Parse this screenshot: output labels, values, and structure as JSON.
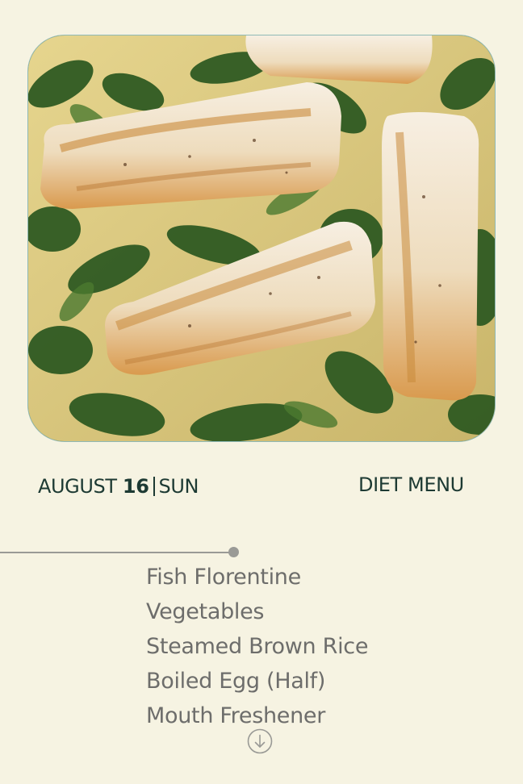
{
  "header": {
    "month": "AUGUST",
    "day": "16",
    "weekday": "SUN",
    "menu_title": "DIET MENU"
  },
  "menu": {
    "items": [
      "Fish Florentine",
      "Vegetables",
      "Steamed Brown Rice",
      "Boiled Egg (Half)",
      "Mouth Freshener"
    ]
  },
  "icons": {
    "scroll": "arrow-down-circle-icon"
  },
  "colors": {
    "background": "#f6f3e2",
    "heading": "#1d3a33",
    "menu_text": "#6d6d6b",
    "divider": "#9a9a96",
    "image_border": "#8fb9b6"
  }
}
